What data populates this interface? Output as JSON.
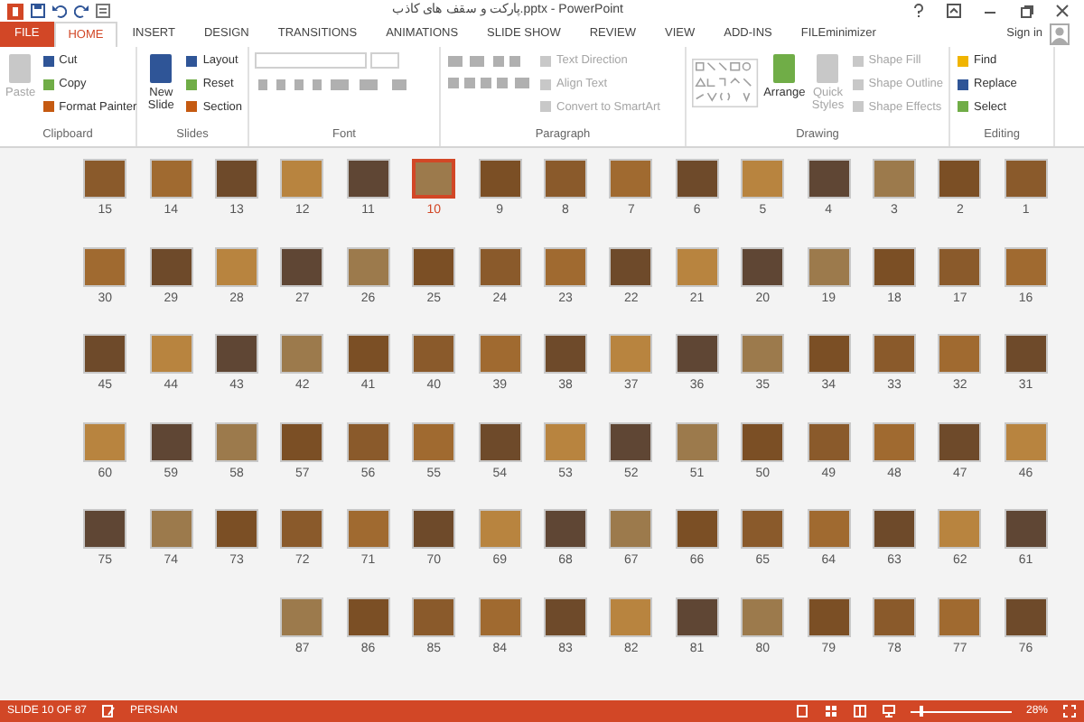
{
  "window": {
    "title": "پارکت و سقف های کاذب.pptx - PowerPoint"
  },
  "tabs": [
    {
      "label": "FILE",
      "kind": "file",
      "selected": false
    },
    {
      "label": "HOME",
      "kind": "tab",
      "selected": true
    },
    {
      "label": "INSERT",
      "kind": "tab",
      "selected": false
    },
    {
      "label": "DESIGN",
      "kind": "tab",
      "selected": false
    },
    {
      "label": "TRANSITIONS",
      "kind": "tab",
      "selected": false
    },
    {
      "label": "ANIMATIONS",
      "kind": "tab",
      "selected": false
    },
    {
      "label": "SLIDE SHOW",
      "kind": "tab",
      "selected": false
    },
    {
      "label": "REVIEW",
      "kind": "tab",
      "selected": false
    },
    {
      "label": "VIEW",
      "kind": "tab",
      "selected": false
    },
    {
      "label": "ADD-INS",
      "kind": "tab",
      "selected": false
    },
    {
      "label": "FILEminimizer",
      "kind": "tab",
      "selected": false
    }
  ],
  "account": {
    "label": "Sign in"
  },
  "ribbon_groups": [
    {
      "label": "Clipboard",
      "items": [
        {
          "label": "Paste",
          "kind": "large",
          "disabled": true
        },
        {
          "label": "Cut",
          "kind": "small",
          "disabled": false
        },
        {
          "label": "Copy",
          "kind": "small",
          "disabled": false
        },
        {
          "label": "Format Painter",
          "kind": "small",
          "disabled": false
        }
      ]
    },
    {
      "label": "Slides",
      "items": [
        {
          "label": "New Slide",
          "kind": "large",
          "disabled": false
        },
        {
          "label": "Layout",
          "kind": "small",
          "disabled": false
        },
        {
          "label": "Reset",
          "kind": "small",
          "disabled": false
        },
        {
          "label": "Section",
          "kind": "small",
          "disabled": false
        }
      ]
    },
    {
      "label": "Font",
      "items": [
        {
          "kind": "font"
        }
      ]
    },
    {
      "label": "Paragraph",
      "items": [
        {
          "kind": "paragraph"
        },
        {
          "label": "Text Direction",
          "kind": "small",
          "disabled": true
        },
        {
          "label": "Align Text",
          "kind": "small",
          "disabled": true
        },
        {
          "label": "Convert to SmartArt",
          "kind": "small",
          "disabled": true
        }
      ]
    },
    {
      "label": "Drawing",
      "items": [
        {
          "kind": "gallery"
        },
        {
          "label": "Arrange",
          "kind": "large",
          "disabled": false
        },
        {
          "label": "Quick Styles",
          "kind": "large",
          "disabled": true
        },
        {
          "label": "Shape Fill",
          "kind": "small",
          "disabled": true
        },
        {
          "label": "Shape Outline",
          "kind": "small",
          "disabled": true
        },
        {
          "label": "Shape Effects",
          "kind": "small",
          "disabled": true
        }
      ]
    },
    {
      "label": "Editing",
      "items": [
        {
          "label": "Find",
          "kind": "small",
          "disabled": false
        },
        {
          "label": "Replace",
          "kind": "small",
          "disabled": false
        },
        {
          "label": "Select",
          "kind": "small",
          "disabled": false
        }
      ]
    }
  ],
  "slides": [
    {
      "number": "15",
      "selected": false
    },
    {
      "number": "14",
      "selected": false
    },
    {
      "number": "13",
      "selected": false
    },
    {
      "number": "12",
      "selected": false
    },
    {
      "number": "11",
      "selected": false
    },
    {
      "number": "10",
      "selected": true
    },
    {
      "number": "9",
      "selected": false
    },
    {
      "number": "8",
      "selected": false
    },
    {
      "number": "7",
      "selected": false
    },
    {
      "number": "6",
      "selected": false
    },
    {
      "number": "5",
      "selected": false
    },
    {
      "number": "4",
      "selected": false
    },
    {
      "number": "3",
      "selected": false
    },
    {
      "number": "2",
      "selected": false
    },
    {
      "number": "1",
      "selected": false
    },
    {
      "number": "30",
      "selected": false
    },
    {
      "number": "29",
      "selected": false
    },
    {
      "number": "28",
      "selected": false
    },
    {
      "number": "27",
      "selected": false
    },
    {
      "number": "26",
      "selected": false
    },
    {
      "number": "25",
      "selected": false
    },
    {
      "number": "24",
      "selected": false
    },
    {
      "number": "23",
      "selected": false
    },
    {
      "number": "22",
      "selected": false
    },
    {
      "number": "21",
      "selected": false
    },
    {
      "number": "20",
      "selected": false
    },
    {
      "number": "19",
      "selected": false
    },
    {
      "number": "18",
      "selected": false
    },
    {
      "number": "17",
      "selected": false
    },
    {
      "number": "16",
      "selected": false
    },
    {
      "number": "45",
      "selected": false
    },
    {
      "number": "44",
      "selected": false
    },
    {
      "number": "43",
      "selected": false
    },
    {
      "number": "42",
      "selected": false
    },
    {
      "number": "41",
      "selected": false
    },
    {
      "number": "40",
      "selected": false
    },
    {
      "number": "39",
      "selected": false
    },
    {
      "number": "38",
      "selected": false
    },
    {
      "number": "37",
      "selected": false
    },
    {
      "number": "36",
      "selected": false
    },
    {
      "number": "35",
      "selected": false
    },
    {
      "number": "34",
      "selected": false
    },
    {
      "number": "33",
      "selected": false
    },
    {
      "number": "32",
      "selected": false
    },
    {
      "number": "31",
      "selected": false
    },
    {
      "number": "60",
      "selected": false
    },
    {
      "number": "59",
      "selected": false
    },
    {
      "number": "58",
      "selected": false
    },
    {
      "number": "57",
      "selected": false
    },
    {
      "number": "56",
      "selected": false
    },
    {
      "number": "55",
      "selected": false
    },
    {
      "number": "54",
      "selected": false
    },
    {
      "number": "53",
      "selected": false
    },
    {
      "number": "52",
      "selected": false
    },
    {
      "number": "51",
      "selected": false
    },
    {
      "number": "50",
      "selected": false
    },
    {
      "number": "49",
      "selected": false
    },
    {
      "number": "48",
      "selected": false
    },
    {
      "number": "47",
      "selected": false
    },
    {
      "number": "46",
      "selected": false
    },
    {
      "number": "75",
      "selected": false
    },
    {
      "number": "74",
      "selected": false
    },
    {
      "number": "73",
      "selected": false
    },
    {
      "number": "72",
      "selected": false
    },
    {
      "number": "71",
      "selected": false
    },
    {
      "number": "70",
      "selected": false
    },
    {
      "number": "69",
      "selected": false
    },
    {
      "number": "68",
      "selected": false
    },
    {
      "number": "67",
      "selected": false
    },
    {
      "number": "66",
      "selected": false
    },
    {
      "number": "65",
      "selected": false
    },
    {
      "number": "64",
      "selected": false
    },
    {
      "number": "63",
      "selected": false
    },
    {
      "number": "62",
      "selected": false
    },
    {
      "number": "61",
      "selected": false
    },
    {
      "number": "87",
      "selected": false
    },
    {
      "number": "86",
      "selected": false
    },
    {
      "number": "85",
      "selected": false
    },
    {
      "number": "84",
      "selected": false
    },
    {
      "number": "83",
      "selected": false
    },
    {
      "number": "82",
      "selected": false
    },
    {
      "number": "81",
      "selected": false
    },
    {
      "number": "80",
      "selected": false
    },
    {
      "number": "79",
      "selected": false
    },
    {
      "number": "78",
      "selected": false
    },
    {
      "number": "77",
      "selected": false
    },
    {
      "number": "76",
      "selected": false
    }
  ],
  "status_bar": {
    "slide": "SLIDE 10 OF 87",
    "language": "PERSIAN",
    "zoom_slider": {
      "level": 0.1
    },
    "zoom": "28%"
  }
}
